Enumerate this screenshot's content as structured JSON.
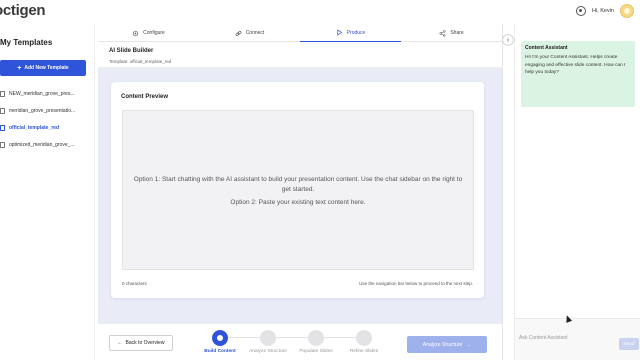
{
  "app": {
    "logo_text": "octigen"
  },
  "user": {
    "greeting": "Hi, Kevin",
    "icon": "user-icon",
    "avatar": "sun-avatar"
  },
  "sidebar": {
    "title": "My Templates",
    "add_label": "Add New Template",
    "items": [
      {
        "label": "NEW_meridian_grove_pres...",
        "active": false
      },
      {
        "label": "meridian_grove_presentatio...",
        "active": false
      },
      {
        "label": "official_template_red",
        "active": true
      },
      {
        "label": "optimized_meridian_grove_...",
        "active": false
      }
    ]
  },
  "tabs": [
    {
      "label": "Configure",
      "icon": "gear-icon",
      "active": false
    },
    {
      "label": "Connect",
      "icon": "link-icon",
      "active": false
    },
    {
      "label": "Produce",
      "icon": "play-icon",
      "active": true
    },
    {
      "label": "Share",
      "icon": "share-icon",
      "active": false
    }
  ],
  "builder": {
    "title": "AI Slide Builder",
    "subtitle": "Template: official_template_red"
  },
  "preview": {
    "title": "Content Preview",
    "option1": "Option 1: Start chatting with the AI assistant to build your presentation content. Use the chat sidebar on the right to get started.",
    "option2": "Option 2: Paste your existing text content here.",
    "char_count": "0 characters",
    "nav_hint": "Use the navigation bar below to proceed to the next step."
  },
  "steps": {
    "back_label": "Back to Overview",
    "items": [
      {
        "label": "Build Content",
        "active": true
      },
      {
        "label": "Analyze Structure",
        "active": false
      },
      {
        "label": "Populate Slides",
        "active": false
      },
      {
        "label": "Refine Slides",
        "active": false
      }
    ],
    "next_label": "Analyze Structure"
  },
  "chat": {
    "assistant_name": "Content Assistant",
    "assistant_message": "Hi! I'm your Content Assistant. Helps create engaging and effective slide content. How can I help you today?",
    "input_placeholder": "Ask Content Assistant",
    "send_label": "Send",
    "collapse_glyph": "‹"
  },
  "colors": {
    "accent": "#2f54d9",
    "assistant_bubble": "#dbf3e3",
    "workspace_bg": "#e9ecf7"
  }
}
